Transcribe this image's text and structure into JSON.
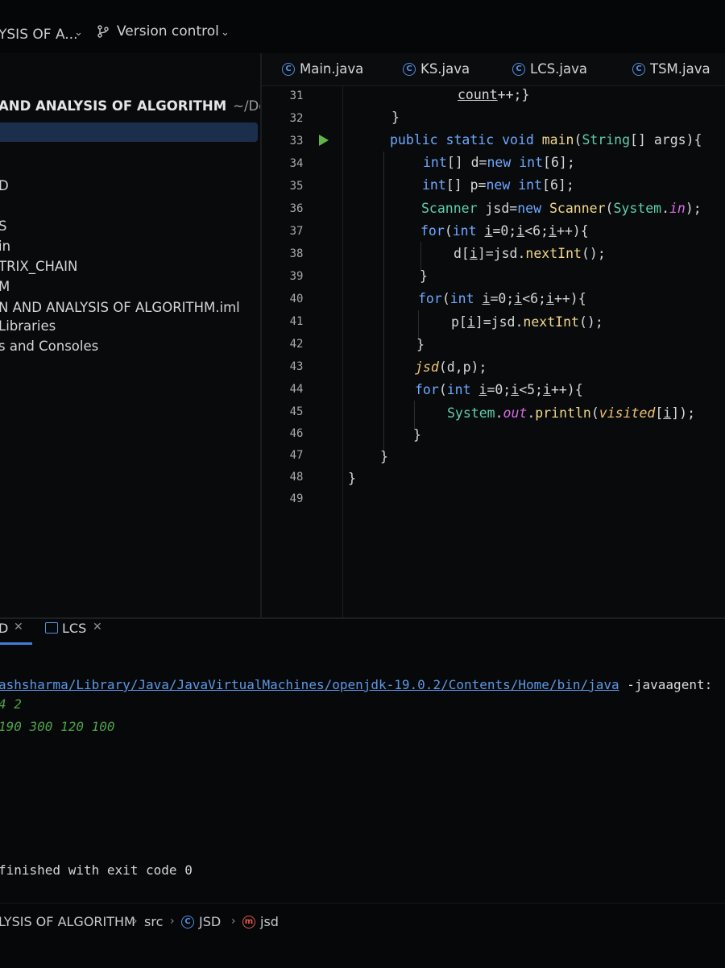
{
  "titlebar": {
    "project": "YSIS OF A...",
    "version_control": "Version control"
  },
  "sidebar": {
    "project_root": "AND ANALYSIS OF ALGORITHM",
    "project_path": "~/Deskto",
    "items": [
      {
        "label": "D"
      },
      {
        "label": "S"
      },
      {
        "label": "in"
      },
      {
        "label": "TRIX_CHAIN"
      },
      {
        "label": "M"
      },
      {
        "label": "N AND ANALYSIS OF ALGORITHM.iml"
      },
      {
        "label": "Libraries"
      },
      {
        "label": "s and Consoles"
      }
    ]
  },
  "editor": {
    "tabs": [
      {
        "label": "Main.java"
      },
      {
        "label": "KS.java"
      },
      {
        "label": "LCS.java"
      },
      {
        "label": "TSM.java"
      }
    ],
    "line_numbers": [
      "31",
      "32",
      "33",
      "34",
      "35",
      "36",
      "37",
      "38",
      "39",
      "40",
      "41",
      "42",
      "43",
      "44",
      "45",
      "46",
      "47",
      "48",
      "49"
    ]
  },
  "console": {
    "tabs": [
      {
        "label": "D"
      },
      {
        "label": "LCS"
      }
    ],
    "command_path": "ashsharma/Library/Java/JavaVirtualMachines/openjdk-19.0.2/Contents/Home/bin/java",
    "command_args": " -javaagent:",
    "output_lines": [
      "4 2",
      "190 300 120 100"
    ],
    "exit_message": "finished with exit code 0"
  },
  "breadcrumb": {
    "items": [
      "LYSIS OF ALGORITHM",
      "src",
      "JSD",
      "jsd"
    ]
  },
  "colors": {
    "background": "#070809",
    "keyword": "#6fa8ff",
    "type": "#5fd0a8",
    "method": "#f2d78a",
    "static_field": "#d66be0",
    "selection": "#1b2f4d",
    "run_icon": "#5fb54a"
  }
}
